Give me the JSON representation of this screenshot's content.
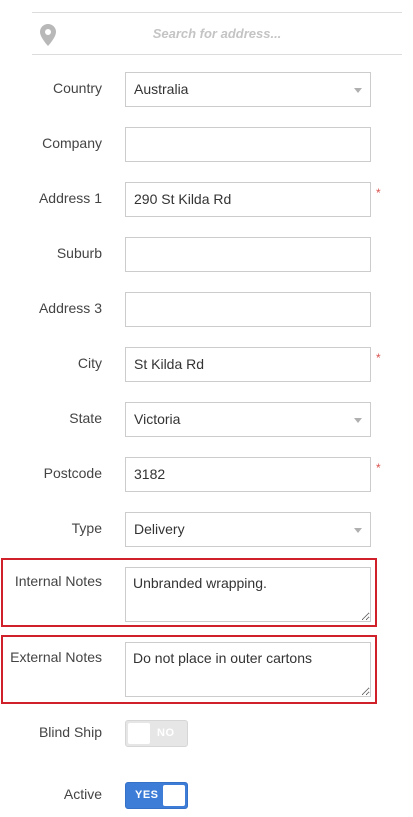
{
  "search": {
    "placeholder": "Search for address...",
    "icon": "map-pin-icon"
  },
  "colors": {
    "highlight": "#d0202a",
    "required": "#d9534f",
    "toggle_on": "#3d7dd8"
  },
  "required_marker": "*",
  "fields": {
    "country": {
      "label": "Country",
      "value": "Australia"
    },
    "company": {
      "label": "Company",
      "value": ""
    },
    "address1": {
      "label": "Address 1",
      "value": "290 St Kilda Rd"
    },
    "suburb": {
      "label": "Suburb",
      "value": ""
    },
    "address3": {
      "label": "Address 3",
      "value": ""
    },
    "city": {
      "label": "City",
      "value": "St Kilda Rd"
    },
    "state": {
      "label": "State",
      "value": "Victoria"
    },
    "postcode": {
      "label": "Postcode",
      "value": "3182"
    },
    "type": {
      "label": "Type",
      "value": "Delivery"
    },
    "internal_notes": {
      "label": "Internal Notes",
      "value": "Unbranded wrapping."
    },
    "external_notes": {
      "label": "External Notes",
      "value": "Do not place in outer cartons"
    }
  },
  "toggles": {
    "blind_ship": {
      "label": "Blind Ship",
      "state": "NO"
    },
    "active": {
      "label": "Active",
      "state": "YES"
    }
  }
}
